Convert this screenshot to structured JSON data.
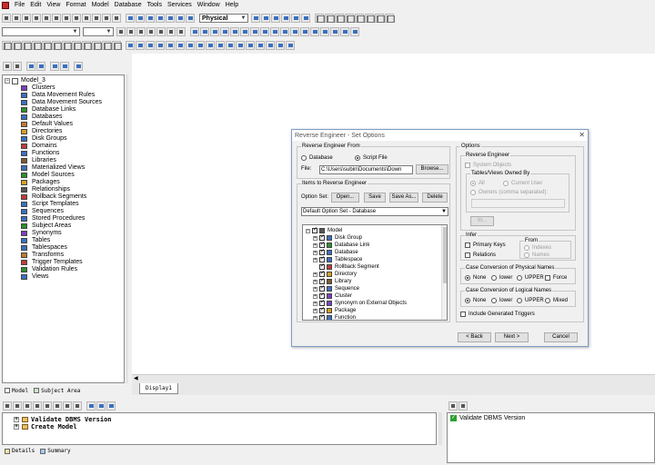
{
  "menubar": {
    "items": [
      "File",
      "Edit",
      "View",
      "Format",
      "Model",
      "Database",
      "Tools",
      "Services",
      "Window",
      "Help"
    ]
  },
  "toolbar": {
    "model_type": "Physical"
  },
  "explorer": {
    "root": "Model_3",
    "items": [
      {
        "label": "Clusters",
        "icon": "cluster-icon",
        "color": "#7b3fbf"
      },
      {
        "label": "Data Movement Rules",
        "icon": "rule-icon",
        "color": "#3b6fbf"
      },
      {
        "label": "Data Movement Sources",
        "icon": "source-icon",
        "color": "#3b6fbf"
      },
      {
        "label": "Database Links",
        "icon": "link-icon",
        "color": "#2f8f2f"
      },
      {
        "label": "Databases",
        "icon": "database-icon",
        "color": "#3b6fbf"
      },
      {
        "label": "Default Values",
        "icon": "default-icon",
        "color": "#bf7b2f"
      },
      {
        "label": "Directories",
        "icon": "folder-icon",
        "color": "#d4a020"
      },
      {
        "label": "Disk Groups",
        "icon": "disk-icon",
        "color": "#3b6fbf"
      },
      {
        "label": "Domains",
        "icon": "domain-icon",
        "color": "#bf3b3b"
      },
      {
        "label": "Functions",
        "icon": "function-icon",
        "color": "#3b6fbf"
      },
      {
        "label": "Libraries",
        "icon": "library-icon",
        "color": "#7b5b2f"
      },
      {
        "label": "Materialized Views",
        "icon": "view-icon",
        "color": "#3b6fbf"
      },
      {
        "label": "Model Sources",
        "icon": "model-source-icon",
        "color": "#2f8f2f"
      },
      {
        "label": "Packages",
        "icon": "package-icon",
        "color": "#d4a020"
      },
      {
        "label": "Relationships",
        "icon": "relationship-icon",
        "color": "#555555"
      },
      {
        "label": "Rollback Segments",
        "icon": "rollback-icon",
        "color": "#bf3b3b"
      },
      {
        "label": "Script Templates",
        "icon": "script-icon",
        "color": "#3b6fbf"
      },
      {
        "label": "Sequences",
        "icon": "sequence-icon",
        "color": "#3b6fbf"
      },
      {
        "label": "Stored Procedures",
        "icon": "procedure-icon",
        "color": "#3b6fbf"
      },
      {
        "label": "Subject Areas",
        "icon": "subject-area-icon",
        "color": "#2f8f2f"
      },
      {
        "label": "Synonyms",
        "icon": "synonym-icon",
        "color": "#7b3fbf"
      },
      {
        "label": "Tables",
        "icon": "table-icon",
        "color": "#3b6fbf"
      },
      {
        "label": "Tablespaces",
        "icon": "tablespace-icon",
        "color": "#3b6fbf"
      },
      {
        "label": "Transforms",
        "icon": "transform-icon",
        "color": "#bf7b2f"
      },
      {
        "label": "Trigger Templates",
        "icon": "trigger-icon",
        "color": "#bf3b3b"
      },
      {
        "label": "Validation Rules",
        "icon": "validation-icon",
        "color": "#2f8f2f"
      },
      {
        "label": "Views",
        "icon": "view-icon",
        "color": "#3b6fbf"
      }
    ],
    "tabs": [
      "Model",
      "Subject Area"
    ]
  },
  "canvas": {
    "tab": "Display1"
  },
  "dialog": {
    "title": "Reverse Engineer - Set Options",
    "from_group": "Reverse Engineer From",
    "from_database": "Database",
    "from_script": "Script File",
    "file_label": "File:",
    "file_path": "C:\\Users\\subin\\Documents\\Down",
    "browse": "Browse...",
    "items_group": "Items to Reverse Engineer",
    "option_set_label": "Option Set:",
    "open_btn": "Open...",
    "save_btn": "Save",
    "save_as_btn": "Save As...",
    "delete_btn": "Delete",
    "option_set_value": "Default Option Set - Database",
    "tree": [
      {
        "label": "Model",
        "level": 0,
        "expand": "-",
        "icon": "model-icon",
        "color": "#555555"
      },
      {
        "label": "Disk Group",
        "level": 1,
        "expand": "+",
        "icon": "disk-icon",
        "color": "#3b6fbf"
      },
      {
        "label": "Database Link",
        "level": 1,
        "expand": "+",
        "icon": "link-icon",
        "color": "#2f8f2f"
      },
      {
        "label": "Database",
        "level": 1,
        "expand": "+",
        "icon": "database-icon",
        "color": "#3b6fbf"
      },
      {
        "label": "Tablespace",
        "level": 1,
        "expand": "+",
        "icon": "tablespace-icon",
        "color": "#3b6fbf"
      },
      {
        "label": "Rollback Segment",
        "level": 1,
        "expand": "",
        "icon": "rollback-icon",
        "color": "#bf3b3b"
      },
      {
        "label": "Directory",
        "level": 1,
        "expand": "+",
        "icon": "folder-icon",
        "color": "#d4a020"
      },
      {
        "label": "Library",
        "level": 1,
        "expand": "+",
        "icon": "library-icon",
        "color": "#7b5b2f"
      },
      {
        "label": "Sequence",
        "level": 1,
        "expand": "+",
        "icon": "sequence-icon",
        "color": "#3b6fbf"
      },
      {
        "label": "Cluster",
        "level": 1,
        "expand": "+",
        "icon": "cluster-icon",
        "color": "#7b3fbf"
      },
      {
        "label": "Synonym on External Objects",
        "level": 1,
        "expand": "+",
        "icon": "synonym-icon",
        "color": "#7b3fbf"
      },
      {
        "label": "Package",
        "level": 1,
        "expand": "+",
        "icon": "package-icon",
        "color": "#d4a020"
      },
      {
        "label": "Function",
        "level": 1,
        "expand": "+",
        "icon": "function-icon",
        "color": "#3b6fbf"
      }
    ],
    "options_group": "Options",
    "re_group": "Reverse Engineer",
    "system_objects": "System Objects",
    "owned_group": "Tables/Views Owned By",
    "owned_all": "All",
    "owned_current": "Current User",
    "owned_owners": "Owners (comma separated):",
    "in_btn": "In...",
    "infer_group": "Infer",
    "primary_keys": "Primary Keys",
    "relations": "Relations",
    "from_group2": "From",
    "indexes": "Indexes",
    "names": "Names",
    "phys_group": "Case Conversion of Physical Names",
    "phys_none": "None",
    "phys_lower": "lower",
    "phys_upper": "UPPER",
    "phys_force": "Force",
    "logical_group": "Case Conversion of Logical Names",
    "log_none": "None",
    "log_lower": "lower",
    "log_upper": "UPPER",
    "log_mixed": "Mixed",
    "include_triggers": "Include Generated Triggers",
    "back_btn": "< Back",
    "next_btn": "Next >",
    "cancel_btn": "Cancel"
  },
  "bottom": {
    "left_rows": [
      "Validate DBMS Version",
      "Create Model"
    ],
    "tabs": [
      "Details",
      "Summary"
    ],
    "right_row": "Validate DBMS Version"
  }
}
